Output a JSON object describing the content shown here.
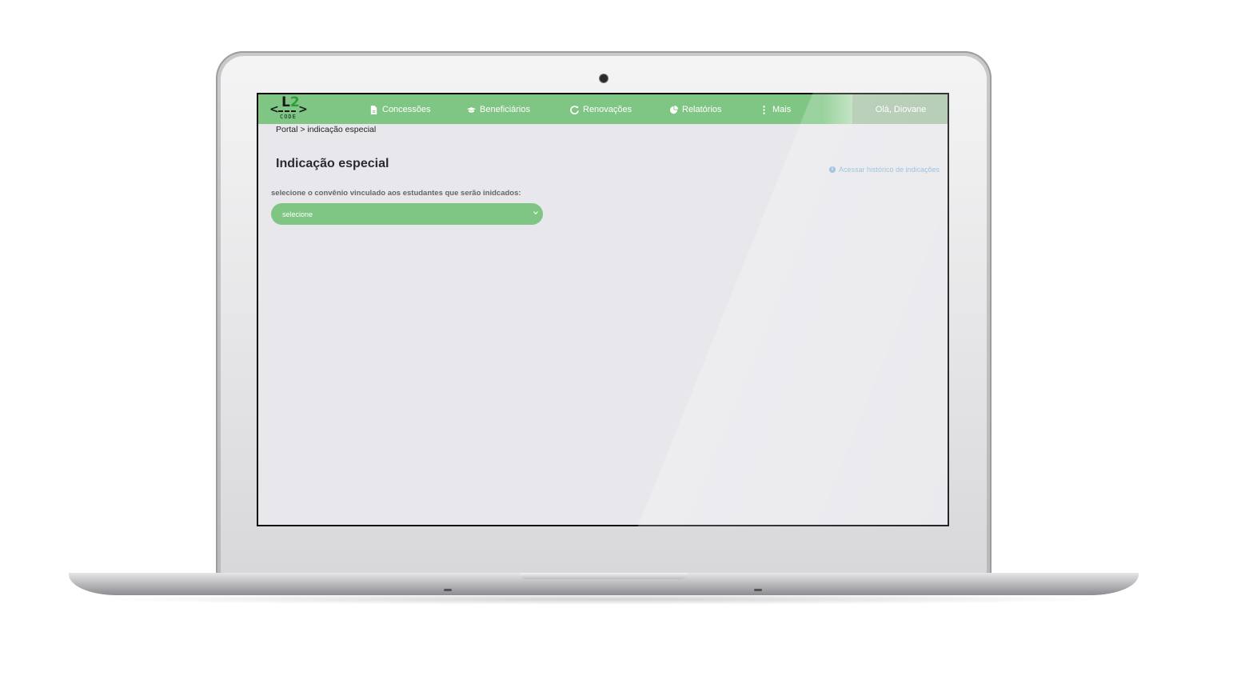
{
  "logo": {
    "left_bracket": "<",
    "digit1": "L",
    "digit2": "2",
    "right_bracket": ">",
    "sub": "CODE"
  },
  "nav": {
    "items": [
      {
        "label": "Concessões",
        "icon": "document-icon"
      },
      {
        "label": "Beneficiários",
        "icon": "graduation-cap-icon"
      },
      {
        "label": "Renovações",
        "icon": "refresh-icon"
      },
      {
        "label": "Relatórios",
        "icon": "pie-chart-icon"
      },
      {
        "label": "Mais",
        "icon": "vertical-dots-icon"
      }
    ],
    "user_greeting": "Olá, Diovane"
  },
  "breadcrumb": "Portal > indicação especial",
  "page": {
    "title": "Indicação especial",
    "history_link": "Acessar histórico de indicações"
  },
  "form": {
    "label": "selecione o convênio vinculado aos estudantes que serão inidcados:",
    "select_value": "selecione"
  },
  "colors": {
    "nav_green": "#7fc684",
    "select_green": "#7fc684",
    "link_blue": "#8ab6d6",
    "screen_bg": "#e8e8ec"
  }
}
